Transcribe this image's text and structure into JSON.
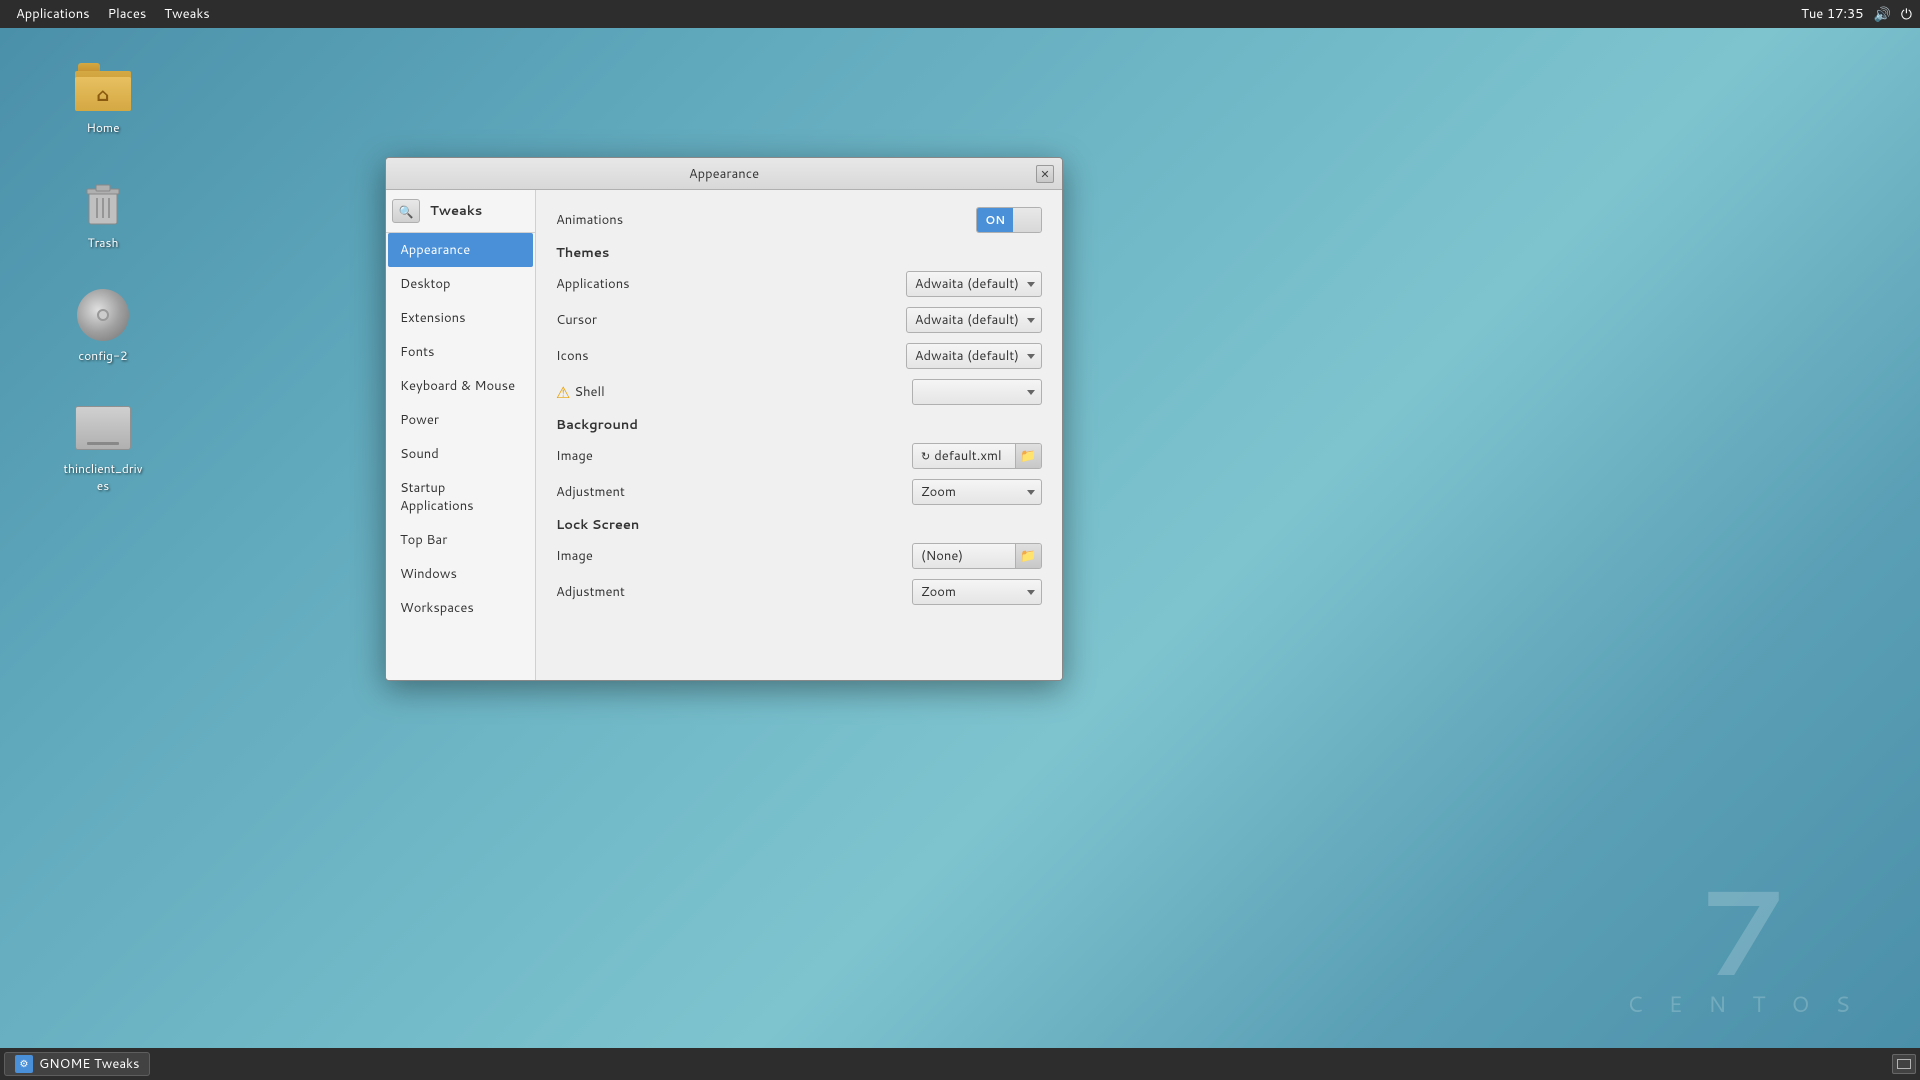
{
  "topPanel": {
    "items": [
      "Applications",
      "Places",
      "Tweaks"
    ],
    "time": "Tue 17:35",
    "icons": [
      "volume",
      "power"
    ]
  },
  "desktop": {
    "icons": [
      {
        "id": "home",
        "label": "Home",
        "type": "folder"
      },
      {
        "id": "trash",
        "label": "Trash",
        "type": "trash"
      },
      {
        "id": "config2",
        "label": "config-2",
        "type": "cd"
      },
      {
        "id": "thinclient",
        "label": "thinclient_drives",
        "type": "drive"
      }
    ]
  },
  "watermark": {
    "number": "7",
    "text": "C E N T O S"
  },
  "taskbar": {
    "app": "GNOME Tweaks"
  },
  "dialog": {
    "title": "Appearance",
    "sidebar": {
      "searchTitle": "Tweaks",
      "items": [
        "Appearance",
        "Desktop",
        "Extensions",
        "Fonts",
        "Keyboard & Mouse",
        "Power",
        "Sound",
        "Startup Applications",
        "Top Bar",
        "Windows",
        "Workspaces"
      ],
      "activeItem": "Appearance"
    },
    "content": {
      "title": "Appearance",
      "animations": {
        "label": "Animations",
        "value": "ON"
      },
      "themes": {
        "header": "Themes",
        "applications": {
          "label": "Applications",
          "value": "Adwaita (default)"
        },
        "cursor": {
          "label": "Cursor",
          "value": "Adwaita (default)"
        },
        "icons": {
          "label": "Icons",
          "value": "Adwaita (default)"
        },
        "shell": {
          "label": "Shell",
          "value": "",
          "hasWarning": true
        }
      },
      "background": {
        "header": "Background",
        "image": {
          "label": "Image",
          "value": "default.xml",
          "hasIcon": true
        },
        "adjustment": {
          "label": "Adjustment",
          "value": "Zoom"
        }
      },
      "lockScreen": {
        "header": "Lock Screen",
        "image": {
          "label": "Image",
          "value": "(None)"
        },
        "adjustment": {
          "label": "Adjustment",
          "value": "Zoom"
        }
      }
    }
  }
}
